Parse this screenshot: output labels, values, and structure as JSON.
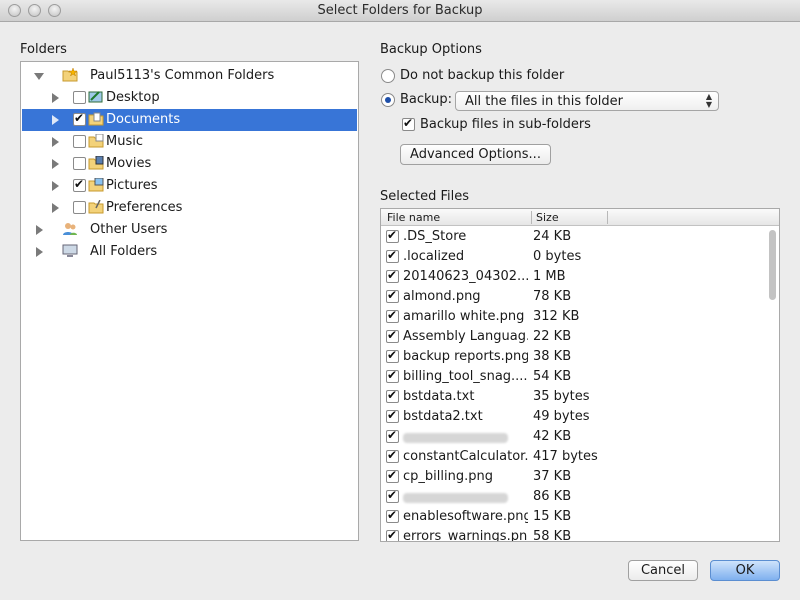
{
  "window": {
    "title": "Select Folders for Backup"
  },
  "folders_panel": {
    "label": "Folders",
    "items": [
      {
        "label": "Paul5113's Common Folders",
        "icon": "star-folder-icon",
        "expanded": true,
        "checkbox": false
      },
      {
        "label": "Desktop",
        "icon": "desktop-folder-icon",
        "checked": false
      },
      {
        "label": "Documents",
        "icon": "documents-folder-icon",
        "checked": true,
        "selected": true
      },
      {
        "label": "Music",
        "icon": "music-folder-icon",
        "checked": false
      },
      {
        "label": "Movies",
        "icon": "movies-folder-icon",
        "checked": false
      },
      {
        "label": "Pictures",
        "icon": "pictures-folder-icon",
        "checked": true
      },
      {
        "label": "Preferences",
        "icon": "preferences-folder-icon",
        "checked": false
      },
      {
        "label": "Other Users",
        "icon": "users-icon",
        "checkbox": false
      },
      {
        "label": "All Folders",
        "icon": "computer-icon",
        "checkbox": false
      }
    ]
  },
  "backup_options": {
    "label": "Backup Options",
    "no_backup_label": "Do not backup this folder",
    "backup_label": "Backup:",
    "backup_selected": true,
    "backup_mode_value": "All the files in this folder",
    "subfolders_label": "Backup files in sub-folders",
    "subfolders_checked": true,
    "advanced_button": "Advanced Options..."
  },
  "selected_files": {
    "label": "Selected Files",
    "columns": {
      "name": "File name",
      "size": "Size"
    },
    "rows": [
      {
        "name": ".DS_Store",
        "size": "24 KB",
        "checked": true
      },
      {
        "name": ".localized",
        "size": "0 bytes",
        "checked": true
      },
      {
        "name": "20140623_04302...",
        "size": "1 MB",
        "checked": true
      },
      {
        "name": "almond.png",
        "size": "78 KB",
        "checked": true
      },
      {
        "name": "amarillo white.png",
        "size": "312 KB",
        "checked": true
      },
      {
        "name": "Assembly Languag...",
        "size": "22 KB",
        "checked": true
      },
      {
        "name": "backup reports.png",
        "size": "38 KB",
        "checked": true
      },
      {
        "name": "billing_tool_snag....",
        "size": "54 KB",
        "checked": true
      },
      {
        "name": "bstdata.txt",
        "size": "35 bytes",
        "checked": true
      },
      {
        "name": "bstdata2.txt",
        "size": "49 bytes",
        "checked": true
      },
      {
        "name": "",
        "size": "42 KB",
        "checked": true,
        "blurred": true
      },
      {
        "name": "constantCalculator...",
        "size": "417 bytes",
        "checked": true
      },
      {
        "name": "cp_billing.png",
        "size": "37 KB",
        "checked": true
      },
      {
        "name": "",
        "size": "86 KB",
        "checked": true,
        "blurred": true
      },
      {
        "name": "enablesoftware.png",
        "size": "15 KB",
        "checked": true
      },
      {
        "name": "errors_warnings.png",
        "size": "58 KB",
        "checked": true
      }
    ]
  },
  "footer": {
    "cancel_label": "Cancel",
    "ok_label": "OK"
  },
  "colors": {
    "selection": "#3875d7",
    "primary_button": "#7fb0ef"
  }
}
